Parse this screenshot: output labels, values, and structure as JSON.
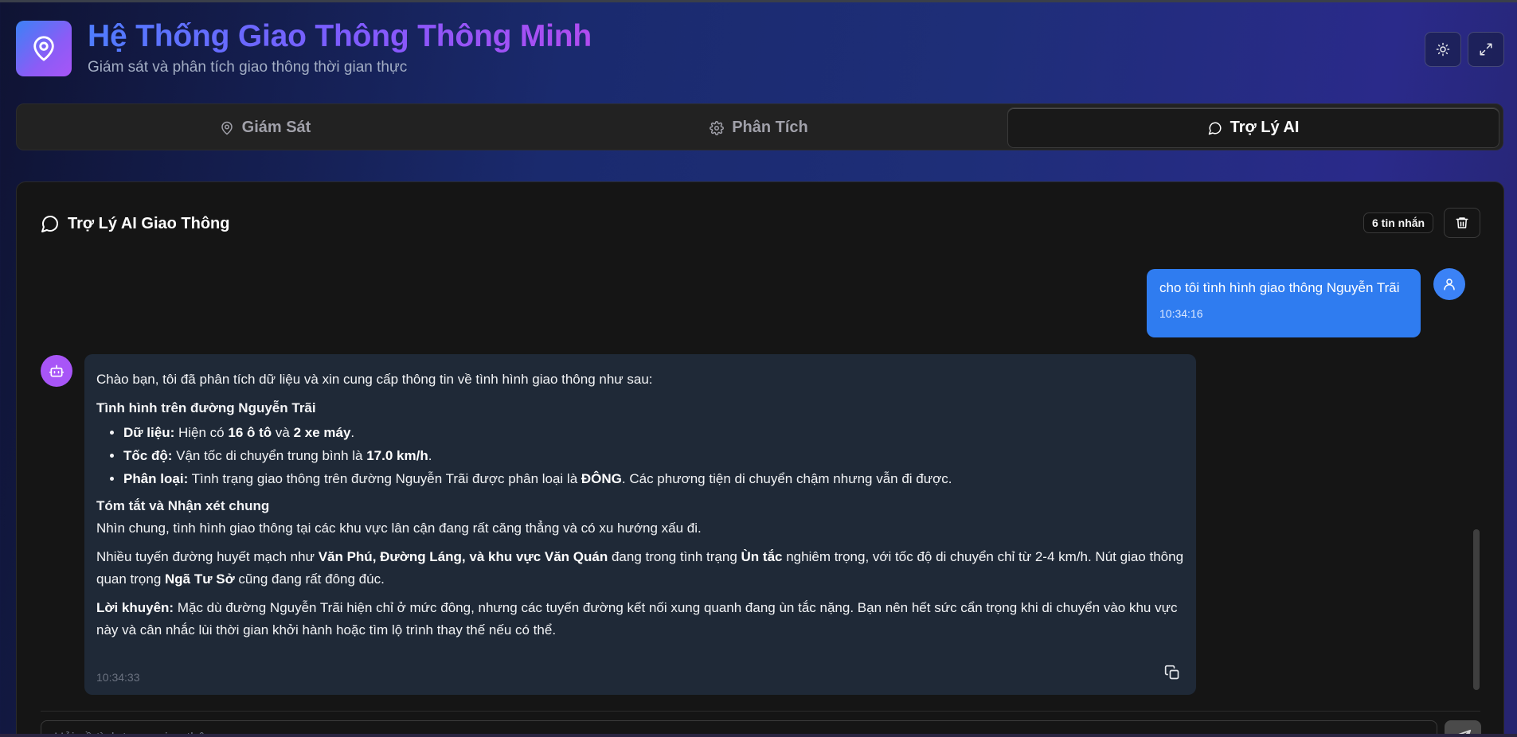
{
  "app": {
    "title": "Hệ Thống Giao Thông Thông Minh",
    "subtitle": "Giám sát và phân tích giao thông thời gian thực",
    "logo_icon": "map-pin-icon",
    "colors": {
      "accent_blue": "#3b82f6",
      "accent_purple": "#a855f7",
      "user_bubble": "#2f7cf0",
      "bot_bubble": "#1f2937"
    }
  },
  "header": {
    "theme_icon": "sun-icon",
    "fullscreen_icon": "expand-icon"
  },
  "tabs": [
    {
      "label": "Giám Sát",
      "icon": "map-pin-icon",
      "active": false
    },
    {
      "label": "Phân Tích",
      "icon": "gear-icon",
      "active": false
    },
    {
      "label": "Trợ Lý AI",
      "icon": "chat-icon",
      "active": true
    }
  ],
  "chat": {
    "title": "Trợ Lý AI Giao Thông",
    "message_count": "6 tin nhắn",
    "input_placeholder": "Hỏi về tình trạng giao thông...",
    "user_message": {
      "text": "cho tôi tình hình giao thông Nguyễn Trãi",
      "time": "10:34:16"
    },
    "bot_message": {
      "intro": "Chào bạn, tôi đã phân tích dữ liệu và xin cung cấp thông tin về tình hình giao thông như sau:",
      "section1_title": "Tình hình trên đường Nguyễn Trãi",
      "bullets": [
        {
          "label": "Dữ liệu:",
          "t1": " Hiện có ",
          "b1": "16 ô tô",
          "t2": " và ",
          "b2": "2 xe máy",
          "t3": "."
        },
        {
          "label": "Tốc độ:",
          "t1": " Vận tốc di chuyển trung bình là ",
          "b1": "17.0 km/h",
          "t2": ".",
          "b2": "",
          "t3": ""
        },
        {
          "label": "Phân loại:",
          "t1": " Tình trạng giao thông trên đường Nguyễn Trãi được phân loại là ",
          "b1": "ĐÔNG",
          "t2": ". Các phương tiện di chuyển chậm nhưng vẫn đi được.",
          "b2": "",
          "t3": ""
        }
      ],
      "section2_title": "Tóm tắt và Nhận xét chung",
      "summary": "Nhìn chung, tình hình giao thông tại các khu vực lân cận đang rất căng thẳng và có xu hướng xấu đi.",
      "p2": {
        "t1": "Nhiều tuyến đường huyết mạch như ",
        "b1": "Văn Phú, Đường Láng, và khu vực Văn Quán",
        "t2": " đang trong tình trạng ",
        "b2": "Ùn tắc",
        "t3": " nghiêm trọng, với tốc độ di chuyển chỉ từ 2-4 km/h. Nút giao thông quan trọng ",
        "b3": "Ngã Tư Sở",
        "t4": " cũng đang rất đông đúc."
      },
      "p3": {
        "label": "Lời khuyên:",
        "text": " Mặc dù đường Nguyễn Trãi hiện chỉ ở mức đông, nhưng các tuyến đường kết nối xung quanh đang ùn tắc nặng. Bạn nên hết sức cẩn trọng khi di chuyển vào khu vực này và cân nhắc lùi thời gian khởi hành hoặc tìm lộ trình thay thế nếu có thể."
      },
      "time": "10:34:33"
    }
  }
}
